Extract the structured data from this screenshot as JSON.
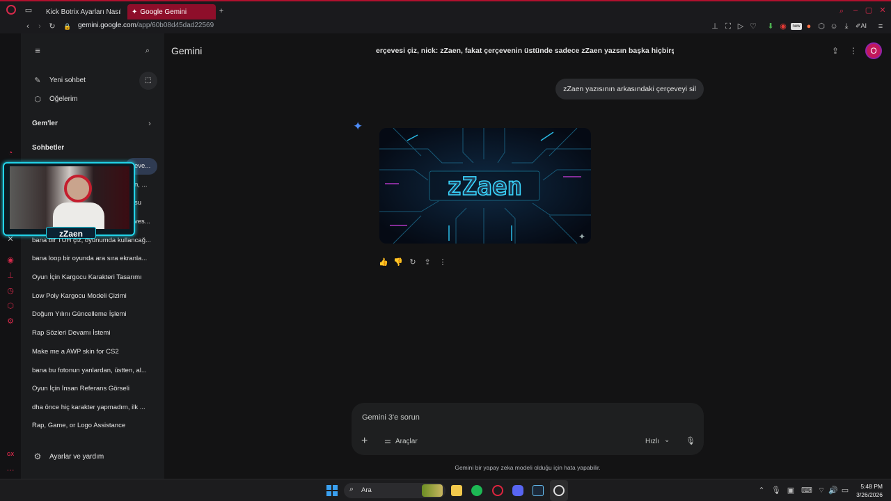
{
  "tabs": [
    {
      "label": "Kick Botrix Ayarları Nasıl Y",
      "icon": "youtube-icon"
    },
    {
      "label": "Google Gemini",
      "icon": "gemini-icon"
    }
  ],
  "address": {
    "host": "gemini.google.com",
    "path": "/app/60b08d45dad22569"
  },
  "header": {
    "app_title": "Gemini",
    "conversation_title": "erçevesi çiz, nick: zZaen, fakat çerçevenin üstünde sadece zZaen yazsın başka hiçbirş",
    "avatar_letter": "O"
  },
  "sidebar": {
    "new_chat": "Yeni sohbet",
    "my_items": "Öğelerim",
    "gems": "Gem'ler",
    "chats_heading": "Sohbetler",
    "chats": [
      "eve...",
      "n, ...",
      "su",
      "ves...",
      "bana bir TUH çiz, oyunumda kullancağ...",
      "bana loop bir oyunda ara sıra ekranla...",
      "Oyun İçin Kargocu Karakteri Tasarımı",
      "Low Poly Kargocu Modeli Çizimi",
      "Doğum Yılını Güncelleme İşlemi",
      "Rap Sözleri Devamı İstemi",
      "Make me a AWP skin for CS2",
      "bana bu fotonun yanlardan, üstten, al...",
      "Oyun İçin İnsan Referans Görseli",
      "dha önce hiç karakter yapmadım, ilk ...",
      "Rap, Game, or Logo Assistance"
    ],
    "settings": "Ayarlar ve yardım"
  },
  "conversation": {
    "user_message": "zZaen yazısının arkasındaki çerçeveyi sil",
    "image_text": "zZaen"
  },
  "webcam": {
    "nick": "zZaen"
  },
  "input": {
    "placeholder": "Gemini 3'e sorun",
    "tools_label": "Araçlar",
    "mode_label": "Hızlı"
  },
  "disclaimer": "Gemini bir yapay zeka modeli olduğu için hata yapabilir.",
  "taskbar": {
    "search_label": "Ara",
    "time": "5:48 PM",
    "date": "3/26/2026"
  },
  "opera_label": "GX",
  "colors": {
    "accent": "#d6294a",
    "bg": "#131314",
    "sidebar": "#1b1c1e",
    "bubble": "#2a2b2e"
  }
}
